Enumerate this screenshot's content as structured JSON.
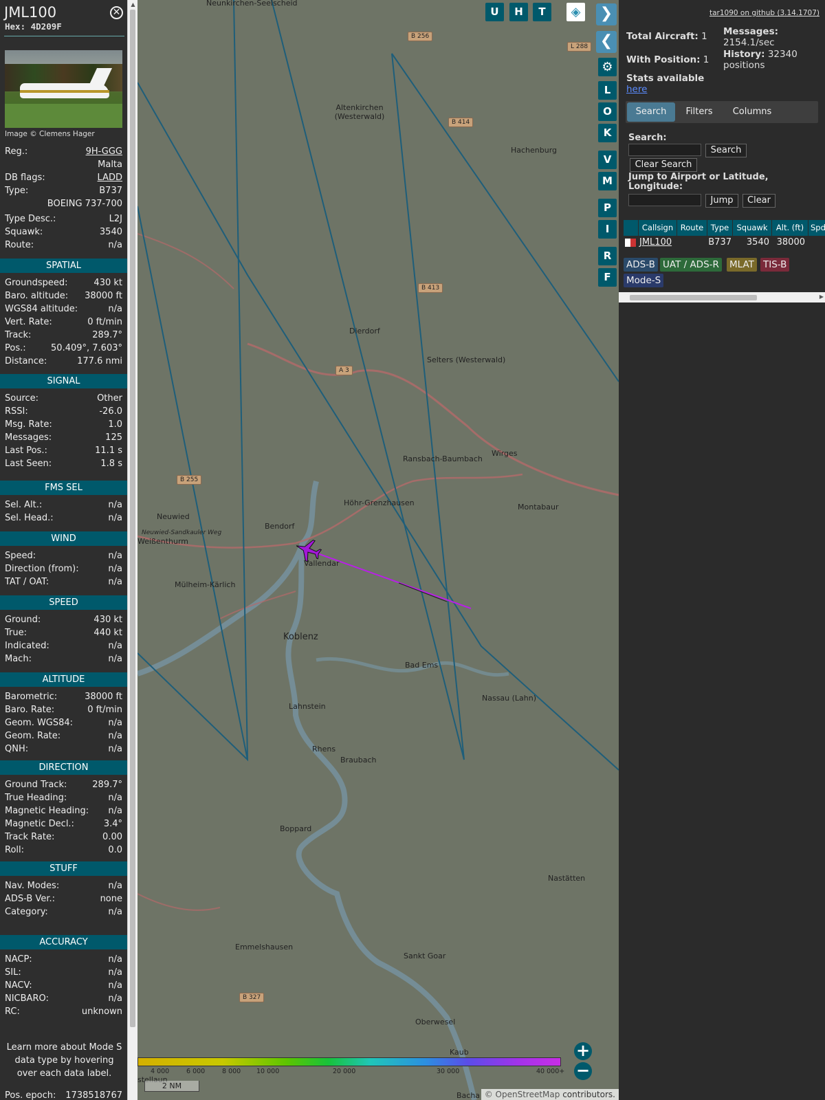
{
  "aircraft": {
    "callsign": "JML100",
    "hex": "Hex: 4D209F",
    "image_credit": "Image © Clemens Hager",
    "reg_label": "Reg.:",
    "reg": "9H-GGG",
    "country": "Malta",
    "dbflags_label": "DB flags:",
    "dbflags": "LADD",
    "type_label": "Type:",
    "type": "B737",
    "type_full": "BOEING 737-700",
    "typedesc_label": "Type Desc.:",
    "typedesc": "L2J",
    "squawk_label": "Squawk:",
    "squawk": "3540",
    "route_label": "Route:",
    "route": "n/a"
  },
  "sections": {
    "spatial": "SPATIAL",
    "signal": "SIGNAL",
    "fms": "FMS SEL",
    "wind": "WIND",
    "speed": "SPEED",
    "altitude": "ALTITUDE",
    "direction": "DIRECTION",
    "stuff": "STUFF",
    "accuracy": "ACCURACY"
  },
  "spatial": [
    {
      "k": "Groundspeed:",
      "v": "430 kt"
    },
    {
      "k": "Baro. altitude:",
      "v": "38000 ft"
    },
    {
      "k": "WGS84 altitude:",
      "v": "n/a"
    },
    {
      "k": "Vert. Rate:",
      "v": "0 ft/min"
    },
    {
      "k": "Track:",
      "v": "289.7°"
    },
    {
      "k": "Pos.:",
      "v": "50.409°, 7.603°"
    },
    {
      "k": "Distance:",
      "v": "177.6 nmi"
    }
  ],
  "signal": [
    {
      "k": "Source:",
      "v": "Other"
    },
    {
      "k": "RSSI:",
      "v": "-26.0"
    },
    {
      "k": "Msg. Rate:",
      "v": "1.0"
    },
    {
      "k": "Messages:",
      "v": "125"
    },
    {
      "k": "Last Pos.:",
      "v": "11.1 s"
    },
    {
      "k": "Last Seen:",
      "v": "1.8 s"
    }
  ],
  "fms": [
    {
      "k": "Sel. Alt.:",
      "v": "n/a"
    },
    {
      "k": "Sel. Head.:",
      "v": "n/a"
    }
  ],
  "wind": [
    {
      "k": "Speed:",
      "v": "n/a"
    },
    {
      "k": "Direction (from):",
      "v": "n/a"
    },
    {
      "k": "TAT / OAT:",
      "v": "n/a"
    }
  ],
  "speed": [
    {
      "k": "Ground:",
      "v": "430 kt"
    },
    {
      "k": "True:",
      "v": "440 kt"
    },
    {
      "k": "Indicated:",
      "v": "n/a"
    },
    {
      "k": "Mach:",
      "v": "n/a"
    }
  ],
  "altitude": [
    {
      "k": "Barometric:",
      "v": "38000 ft"
    },
    {
      "k": "Baro. Rate:",
      "v": "0 ft/min"
    },
    {
      "k": "Geom. WGS84:",
      "v": "n/a"
    },
    {
      "k": "Geom. Rate:",
      "v": "n/a"
    },
    {
      "k": "QNH:",
      "v": "n/a"
    }
  ],
  "direction": [
    {
      "k": "Ground Track:",
      "v": "289.7°"
    },
    {
      "k": "True Heading:",
      "v": "n/a"
    },
    {
      "k": "Magnetic Heading:",
      "v": "n/a"
    },
    {
      "k": "Magnetic Decl.:",
      "v": "3.4°"
    },
    {
      "k": "Track Rate:",
      "v": "0.00"
    },
    {
      "k": "Roll:",
      "v": "0.0"
    }
  ],
  "stuff": [
    {
      "k": "Nav. Modes:",
      "v": "n/a"
    },
    {
      "k": "ADS-B Ver.:",
      "v": "none"
    },
    {
      "k": "Category:",
      "v": "n/a"
    }
  ],
  "accuracy": [
    {
      "k": "NACP:",
      "v": "n/a"
    },
    {
      "k": "SIL:",
      "v": "n/a"
    },
    {
      "k": "NACV:",
      "v": "n/a"
    },
    {
      "k": "NICBARO:",
      "v": "n/a"
    },
    {
      "k": "RC:",
      "v": "unknown"
    }
  ],
  "learn_more": "Learn more about Mode S data type by hovering over each data label.",
  "pos_epoch_label": "Pos. epoch:",
  "pos_epoch": "1738518767",
  "map": {
    "buttons": [
      "U",
      "H",
      "T"
    ],
    "side_buttons": [
      "L",
      "O",
      "K",
      "V",
      "M",
      "P",
      "I",
      "R",
      "F"
    ],
    "places": [
      "Neunkirchen-Seelscheid",
      "Altenkirchen (Westerwald)",
      "Hachenburg",
      "Dierdorf",
      "Selters (Westerwald)",
      "Ransbach-Baumbach",
      "Wirges",
      "Montabaur",
      "Höhr-Grenzhausen",
      "Neuwied",
      "Bendorf",
      "Weißenthurm",
      "Vallendar",
      "Mülheim-Kärlich",
      "Koblenz",
      "Bad Ems",
      "Nassau (Lahn)",
      "Lahnstein",
      "Rhens",
      "Braubach",
      "Boppard",
      "Nastätten",
      "Emmelshausen",
      "Sankt Goar",
      "Oberwesel",
      "Kaub",
      "Neuwied-Sandkauler Weg"
    ],
    "roads": [
      "B 256",
      "L 288",
      "B 414",
      "B 413",
      "A 3",
      "B 255",
      "B 327"
    ],
    "scale": "2 NM",
    "color_labels": [
      "4 000",
      "6 000",
      "8 000",
      "10 000",
      "20 000",
      "30 000",
      "40 000+"
    ],
    "attribution_symbol": "©",
    "attribution_link": "OpenStreetMap",
    "attribution_rest": "contributors.",
    "partial_labels": [
      "stellaun",
      "Bacha"
    ]
  },
  "panel": {
    "github": "tar1090 on github (3.14.1707)",
    "total_aircraft_label": "Total Aircraft:",
    "total_aircraft": "1",
    "with_position_label": "With Position:",
    "with_position": "1",
    "messages_label": "Messages:",
    "messages": "2154.1/sec",
    "history_label": "History:",
    "history": "32340 positions",
    "stats_label": "Stats available",
    "stats_link": "here",
    "tabs": [
      "Search",
      "Filters",
      "Columns"
    ],
    "search_label": "Search:",
    "search_button": "Search",
    "clear_search": "Clear Search",
    "jump_label": "Jump to Airport or Latitude, Longitude:",
    "jump_button": "Jump",
    "clear_button": "Clear",
    "columns": [
      "Callsign",
      "Route",
      "Type",
      "Squawk",
      "Alt. (ft)",
      "Spd."
    ],
    "row": {
      "callsign": "JML100",
      "route": "",
      "type": "B737",
      "squawk": "3540",
      "alt": "38000"
    },
    "badges": [
      "ADS-B",
      "UAT / ADS-R",
      "MLAT",
      "TIS-B",
      "Mode-S"
    ]
  },
  "colors": {
    "section": "#00596b",
    "track": "#b820e6",
    "plane": "#a318d8"
  }
}
